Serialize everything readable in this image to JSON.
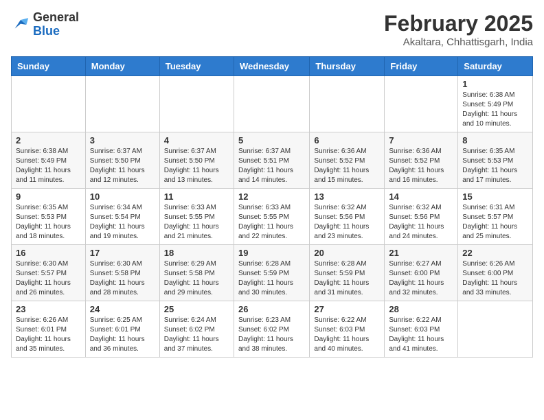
{
  "header": {
    "logo_general": "General",
    "logo_blue": "Blue",
    "month_year": "February 2025",
    "location": "Akaltara, Chhattisgarh, India"
  },
  "days_of_week": [
    "Sunday",
    "Monday",
    "Tuesday",
    "Wednesday",
    "Thursday",
    "Friday",
    "Saturday"
  ],
  "weeks": [
    [
      {
        "day": "",
        "info": ""
      },
      {
        "day": "",
        "info": ""
      },
      {
        "day": "",
        "info": ""
      },
      {
        "day": "",
        "info": ""
      },
      {
        "day": "",
        "info": ""
      },
      {
        "day": "",
        "info": ""
      },
      {
        "day": "1",
        "info": "Sunrise: 6:38 AM\nSunset: 5:49 PM\nDaylight: 11 hours\nand 10 minutes."
      }
    ],
    [
      {
        "day": "2",
        "info": "Sunrise: 6:38 AM\nSunset: 5:49 PM\nDaylight: 11 hours\nand 11 minutes."
      },
      {
        "day": "3",
        "info": "Sunrise: 6:37 AM\nSunset: 5:50 PM\nDaylight: 11 hours\nand 12 minutes."
      },
      {
        "day": "4",
        "info": "Sunrise: 6:37 AM\nSunset: 5:50 PM\nDaylight: 11 hours\nand 13 minutes."
      },
      {
        "day": "5",
        "info": "Sunrise: 6:37 AM\nSunset: 5:51 PM\nDaylight: 11 hours\nand 14 minutes."
      },
      {
        "day": "6",
        "info": "Sunrise: 6:36 AM\nSunset: 5:52 PM\nDaylight: 11 hours\nand 15 minutes."
      },
      {
        "day": "7",
        "info": "Sunrise: 6:36 AM\nSunset: 5:52 PM\nDaylight: 11 hours\nand 16 minutes."
      },
      {
        "day": "8",
        "info": "Sunrise: 6:35 AM\nSunset: 5:53 PM\nDaylight: 11 hours\nand 17 minutes."
      }
    ],
    [
      {
        "day": "9",
        "info": "Sunrise: 6:35 AM\nSunset: 5:53 PM\nDaylight: 11 hours\nand 18 minutes."
      },
      {
        "day": "10",
        "info": "Sunrise: 6:34 AM\nSunset: 5:54 PM\nDaylight: 11 hours\nand 19 minutes."
      },
      {
        "day": "11",
        "info": "Sunrise: 6:33 AM\nSunset: 5:55 PM\nDaylight: 11 hours\nand 21 minutes."
      },
      {
        "day": "12",
        "info": "Sunrise: 6:33 AM\nSunset: 5:55 PM\nDaylight: 11 hours\nand 22 minutes."
      },
      {
        "day": "13",
        "info": "Sunrise: 6:32 AM\nSunset: 5:56 PM\nDaylight: 11 hours\nand 23 minutes."
      },
      {
        "day": "14",
        "info": "Sunrise: 6:32 AM\nSunset: 5:56 PM\nDaylight: 11 hours\nand 24 minutes."
      },
      {
        "day": "15",
        "info": "Sunrise: 6:31 AM\nSunset: 5:57 PM\nDaylight: 11 hours\nand 25 minutes."
      }
    ],
    [
      {
        "day": "16",
        "info": "Sunrise: 6:30 AM\nSunset: 5:57 PM\nDaylight: 11 hours\nand 26 minutes."
      },
      {
        "day": "17",
        "info": "Sunrise: 6:30 AM\nSunset: 5:58 PM\nDaylight: 11 hours\nand 28 minutes."
      },
      {
        "day": "18",
        "info": "Sunrise: 6:29 AM\nSunset: 5:58 PM\nDaylight: 11 hours\nand 29 minutes."
      },
      {
        "day": "19",
        "info": "Sunrise: 6:28 AM\nSunset: 5:59 PM\nDaylight: 11 hours\nand 30 minutes."
      },
      {
        "day": "20",
        "info": "Sunrise: 6:28 AM\nSunset: 5:59 PM\nDaylight: 11 hours\nand 31 minutes."
      },
      {
        "day": "21",
        "info": "Sunrise: 6:27 AM\nSunset: 6:00 PM\nDaylight: 11 hours\nand 32 minutes."
      },
      {
        "day": "22",
        "info": "Sunrise: 6:26 AM\nSunset: 6:00 PM\nDaylight: 11 hours\nand 33 minutes."
      }
    ],
    [
      {
        "day": "23",
        "info": "Sunrise: 6:26 AM\nSunset: 6:01 PM\nDaylight: 11 hours\nand 35 minutes."
      },
      {
        "day": "24",
        "info": "Sunrise: 6:25 AM\nSunset: 6:01 PM\nDaylight: 11 hours\nand 36 minutes."
      },
      {
        "day": "25",
        "info": "Sunrise: 6:24 AM\nSunset: 6:02 PM\nDaylight: 11 hours\nand 37 minutes."
      },
      {
        "day": "26",
        "info": "Sunrise: 6:23 AM\nSunset: 6:02 PM\nDaylight: 11 hours\nand 38 minutes."
      },
      {
        "day": "27",
        "info": "Sunrise: 6:22 AM\nSunset: 6:03 PM\nDaylight: 11 hours\nand 40 minutes."
      },
      {
        "day": "28",
        "info": "Sunrise: 6:22 AM\nSunset: 6:03 PM\nDaylight: 11 hours\nand 41 minutes."
      },
      {
        "day": "",
        "info": ""
      }
    ]
  ]
}
